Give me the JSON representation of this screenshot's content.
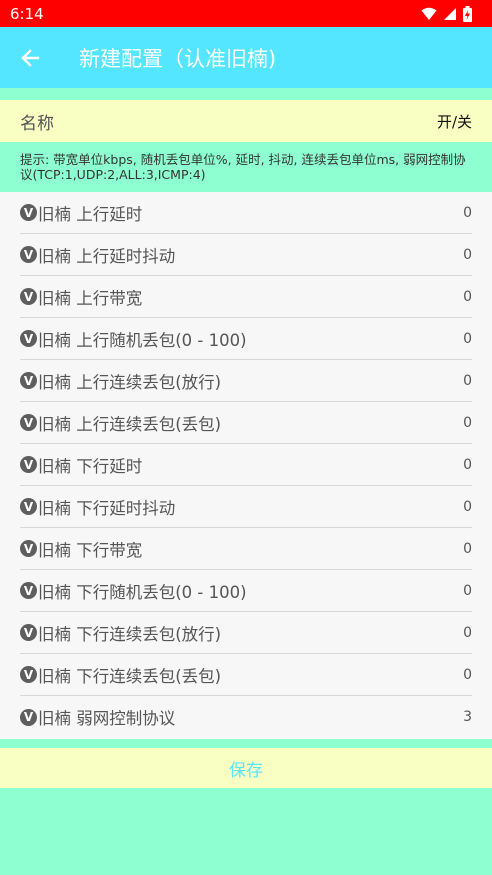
{
  "status_bar": {
    "time": "6:14",
    "icons": [
      "wifi-icon",
      "signal-icon",
      "battery-charging-icon"
    ]
  },
  "app_bar": {
    "back_icon": "arrow-left-icon",
    "title": "新建配置（认准旧楠)"
  },
  "config": {
    "name_label": "名称",
    "toggle_label": "开/关",
    "tip": "提示: 带宽单位kbps, 随机丢包单位%, 延时, 抖动, 连续丢包单位ms, 弱网控制协议(TCP:1,UDP:2,ALL:3,ICMP:4)"
  },
  "items": [
    {
      "badge": "V",
      "label": "旧楠 上行延时",
      "value": "0"
    },
    {
      "badge": "V",
      "label": "旧楠 上行延时抖动",
      "value": "0"
    },
    {
      "badge": "V",
      "label": "旧楠 上行带宽",
      "value": "0"
    },
    {
      "badge": "V",
      "label": "旧楠 上行随机丢包(0 - 100)",
      "value": "0"
    },
    {
      "badge": "V",
      "label": "旧楠 上行连续丢包(放行)",
      "value": "0"
    },
    {
      "badge": "V",
      "label": "旧楠 上行连续丢包(丢包)",
      "value": "0"
    },
    {
      "badge": "V",
      "label": "旧楠 下行延时",
      "value": "0"
    },
    {
      "badge": "V",
      "label": "旧楠 下行延时抖动",
      "value": "0"
    },
    {
      "badge": "V",
      "label": "旧楠 下行带宽",
      "value": "0"
    },
    {
      "badge": "V",
      "label": "旧楠 下行随机丢包(0 - 100)",
      "value": "0"
    },
    {
      "badge": "V",
      "label": "旧楠 下行连续丢包(放行)",
      "value": "0"
    },
    {
      "badge": "V",
      "label": "旧楠 下行连续丢包(丢包)",
      "value": "0"
    },
    {
      "badge": "V",
      "label": "旧楠 弱网控制协议",
      "value": "3"
    }
  ],
  "save_label": "保存",
  "colors": {
    "status_bar": "#ff0000",
    "app_bar": "#55e6ff",
    "mint_background": "#8dffd0",
    "cream_row": "#f9ffc3",
    "list_background": "#f7f7f7"
  }
}
